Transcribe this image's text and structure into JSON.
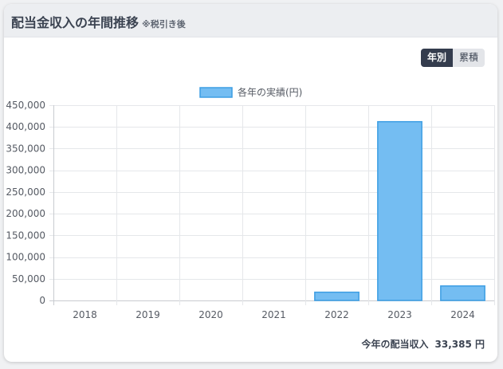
{
  "header": {
    "title": "配当金収入の年間推移",
    "note": "※税引き後"
  },
  "toggle": {
    "options": [
      "年別",
      "累積"
    ],
    "active": "年別"
  },
  "chart_data": {
    "type": "bar",
    "categories": [
      "2018",
      "2019",
      "2020",
      "2021",
      "2022",
      "2023",
      "2024"
    ],
    "series": [
      {
        "name": "各年の実績(円)",
        "values": [
          0,
          0,
          0,
          0,
          19000,
          412000,
          33385
        ]
      }
    ],
    "ylim": [
      0,
      450000
    ],
    "yticks": [
      0,
      50000,
      100000,
      150000,
      200000,
      250000,
      300000,
      350000,
      400000,
      450000
    ],
    "grid": true,
    "legend": "top-center",
    "colors": {
      "fill": "#74bdf2",
      "stroke": "#3d9ee3"
    }
  },
  "summary": {
    "label": "今年の配当収入",
    "value": "33,385 円"
  }
}
